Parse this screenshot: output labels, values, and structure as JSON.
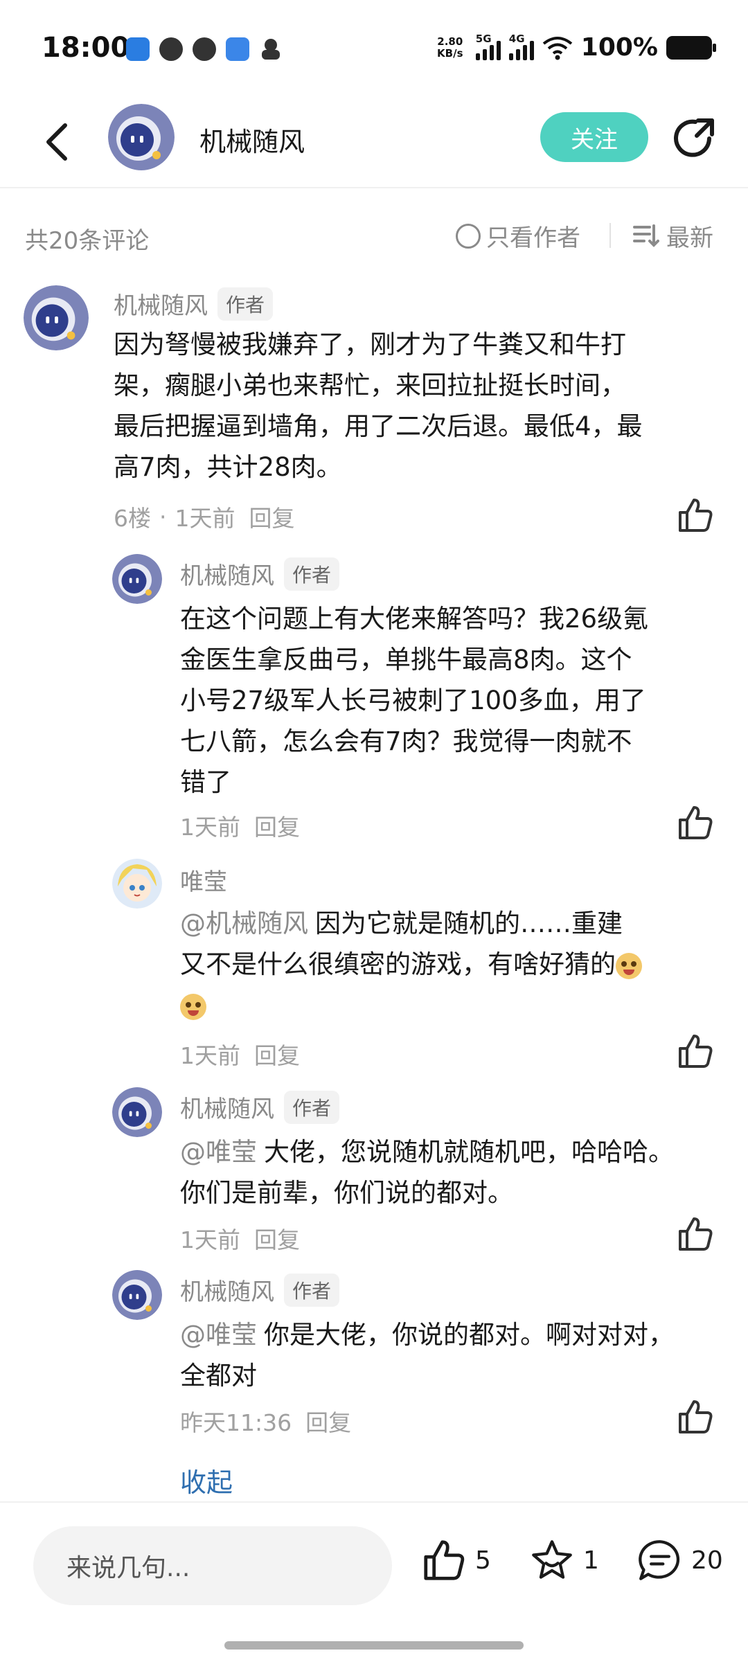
{
  "status_bar": {
    "time": "18:00",
    "net_speed_value": "2.80",
    "net_speed_unit": "KB/s",
    "signal1_tag": "5G",
    "signal2_tag": "4G",
    "battery": "100%"
  },
  "header": {
    "author_name": "机械随风",
    "follow_label": "关注"
  },
  "sort_bar": {
    "count_label": "共20条评论",
    "only_author_label": "只看作者",
    "sort_label": "最新"
  },
  "comments": [
    {
      "name": "机械随风",
      "badge": "作者",
      "text_lines": [
        "因为弩慢被我嫌弃了，刚才为了牛粪又和牛打",
        "架，瘸腿小弟也来帮忙，来回拉扯挺长时间，",
        "最后把握逼到墙角，用了二次后退。最低4，最",
        "高7肉，共计28肉。"
      ],
      "floor": "6楼",
      "dot": "·",
      "time": "1天前",
      "reply": "回复"
    },
    {
      "name": "机械随风",
      "badge": "作者",
      "text_lines": [
        "在这个问题上有大佬来解答吗？我26级氪",
        "金医生拿反曲弓，单挑牛最高8肉。这个",
        "小号27级军人长弓被刺了100多血，用了",
        "七八箭，怎么会有7肉？我觉得一肉就不",
        "错了"
      ],
      "time": "1天前",
      "reply": "回复"
    },
    {
      "name": "唯莹",
      "mention": "@机械随风",
      "text_line1": "因为它就是随机的……重建",
      "text_line2": "又不是什么很缜密的游戏，有啥好猜的",
      "time": "1天前",
      "reply": "回复"
    },
    {
      "name": "机械随风",
      "badge": "作者",
      "mention": "@唯莹",
      "text_line1": "大佬，您说随机就随机吧，哈哈哈。",
      "text_line2": "你们是前辈，你们说的都对。",
      "time": "1天前",
      "reply": "回复"
    },
    {
      "name": "机械随风",
      "badge": "作者",
      "mention": "@唯莹",
      "text_line1": "你是大佬，你说的都对。啊对对对，",
      "text_line2": "全都对",
      "time": "昨天11:36",
      "reply": "回复"
    }
  ],
  "collapse_label": "收起",
  "bottom_bar": {
    "input_placeholder": "来说几句...",
    "like_count": "5",
    "fav_count": "1",
    "comment_count": "20"
  }
}
